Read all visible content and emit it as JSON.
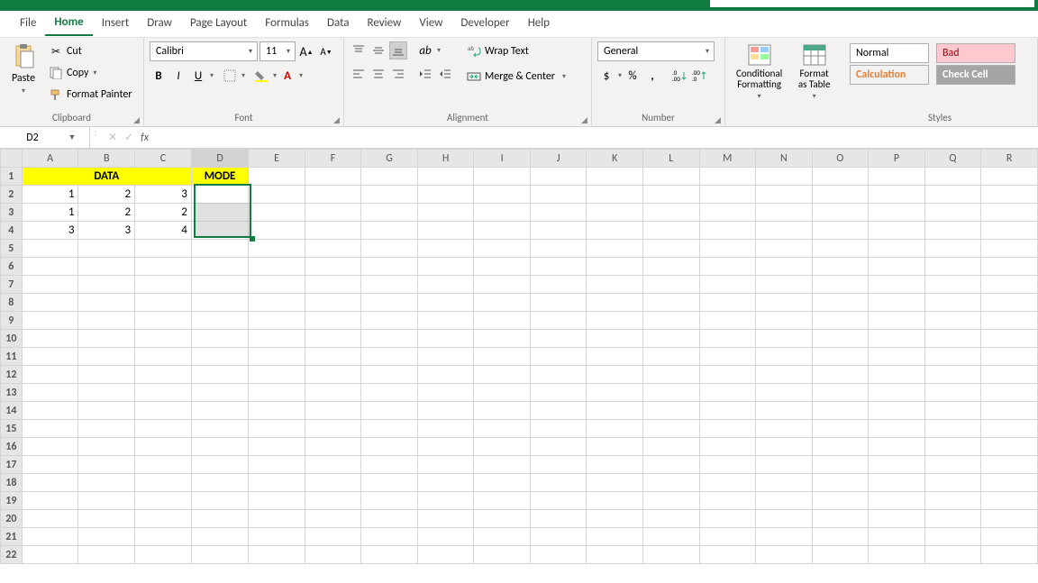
{
  "tabs": [
    "File",
    "Home",
    "Insert",
    "Draw",
    "Page Layout",
    "Formulas",
    "Data",
    "Review",
    "View",
    "Developer",
    "Help"
  ],
  "active_tab": "Home",
  "clipboard": {
    "paste": "Paste",
    "cut": "Cut",
    "copy": "Copy",
    "format_painter": "Format Painter",
    "label": "Clipboard"
  },
  "font": {
    "family": "Calibri",
    "size": "11",
    "label": "Font"
  },
  "alignment": {
    "wrap": "Wrap Text",
    "merge": "Merge & Center",
    "label": "Alignment"
  },
  "number": {
    "format": "General",
    "label": "Number"
  },
  "cond_fmt": "Conditional Formatting",
  "fmt_table": "Format as Table",
  "styles": {
    "normal": "Normal",
    "bad": "Bad",
    "calc": "Calculation",
    "check": "Check Cell",
    "label": "Styles"
  },
  "namebox": "D2",
  "formula": "",
  "columns": [
    "A",
    "B",
    "C",
    "D",
    "E",
    "F",
    "G",
    "H",
    "I",
    "J",
    "K",
    "L",
    "M",
    "N",
    "O",
    "P",
    "Q",
    "R"
  ],
  "rows": 22,
  "cells": {
    "A1": "DATA",
    "D1": "MODE",
    "A2": "1",
    "B2": "2",
    "C2": "3",
    "A3": "1",
    "B3": "2",
    "C3": "2",
    "A4": "3",
    "B4": "3",
    "C4": "4"
  },
  "merged_header_range": "A1:C1",
  "selection": {
    "start": "D2",
    "end": "D4",
    "active": "D2"
  }
}
